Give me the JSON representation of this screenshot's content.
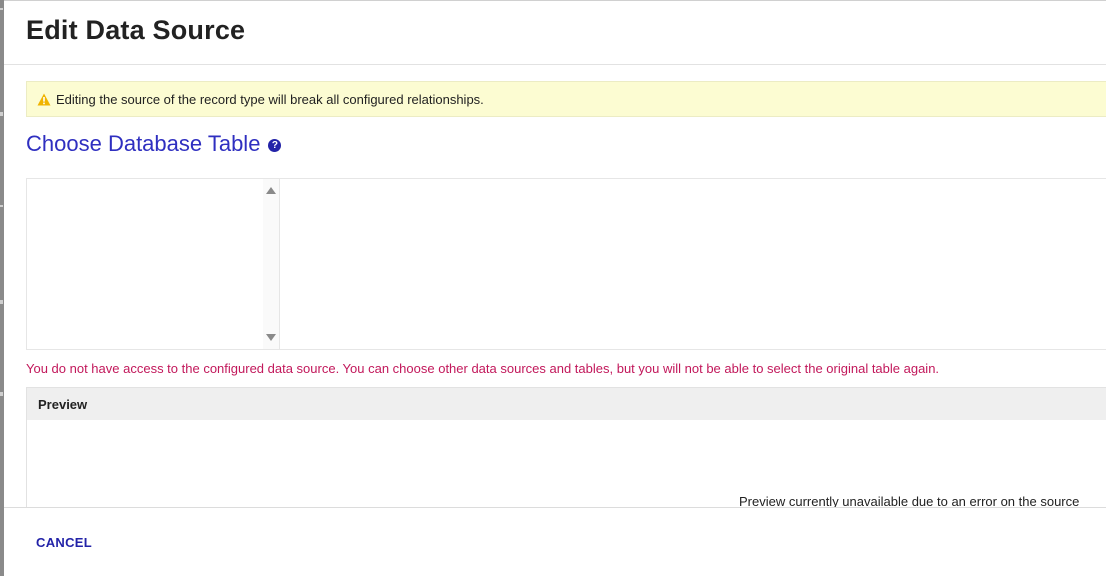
{
  "dialog": {
    "title": "Edit Data Source"
  },
  "warning": {
    "icon": "warning-triangle-icon",
    "text": "Editing the source of the record type will break all configured relationships."
  },
  "section": {
    "title": "Choose Database Table",
    "help_icon": "question-circle-icon",
    "help_glyph": "?"
  },
  "error": {
    "text": "You do not have access to the configured data source. You can choose other data sources and tables, but you will not be able to select the original table again."
  },
  "preview": {
    "header": "Preview",
    "message": "Preview currently unavailable due to an error on the source"
  },
  "footer": {
    "cancel_label": "CANCEL"
  },
  "colors": {
    "accent": "#2f2fc0",
    "error": "#c2185b",
    "warning_bg": "#fcfcd2",
    "warning_icon": "#f0b400"
  }
}
